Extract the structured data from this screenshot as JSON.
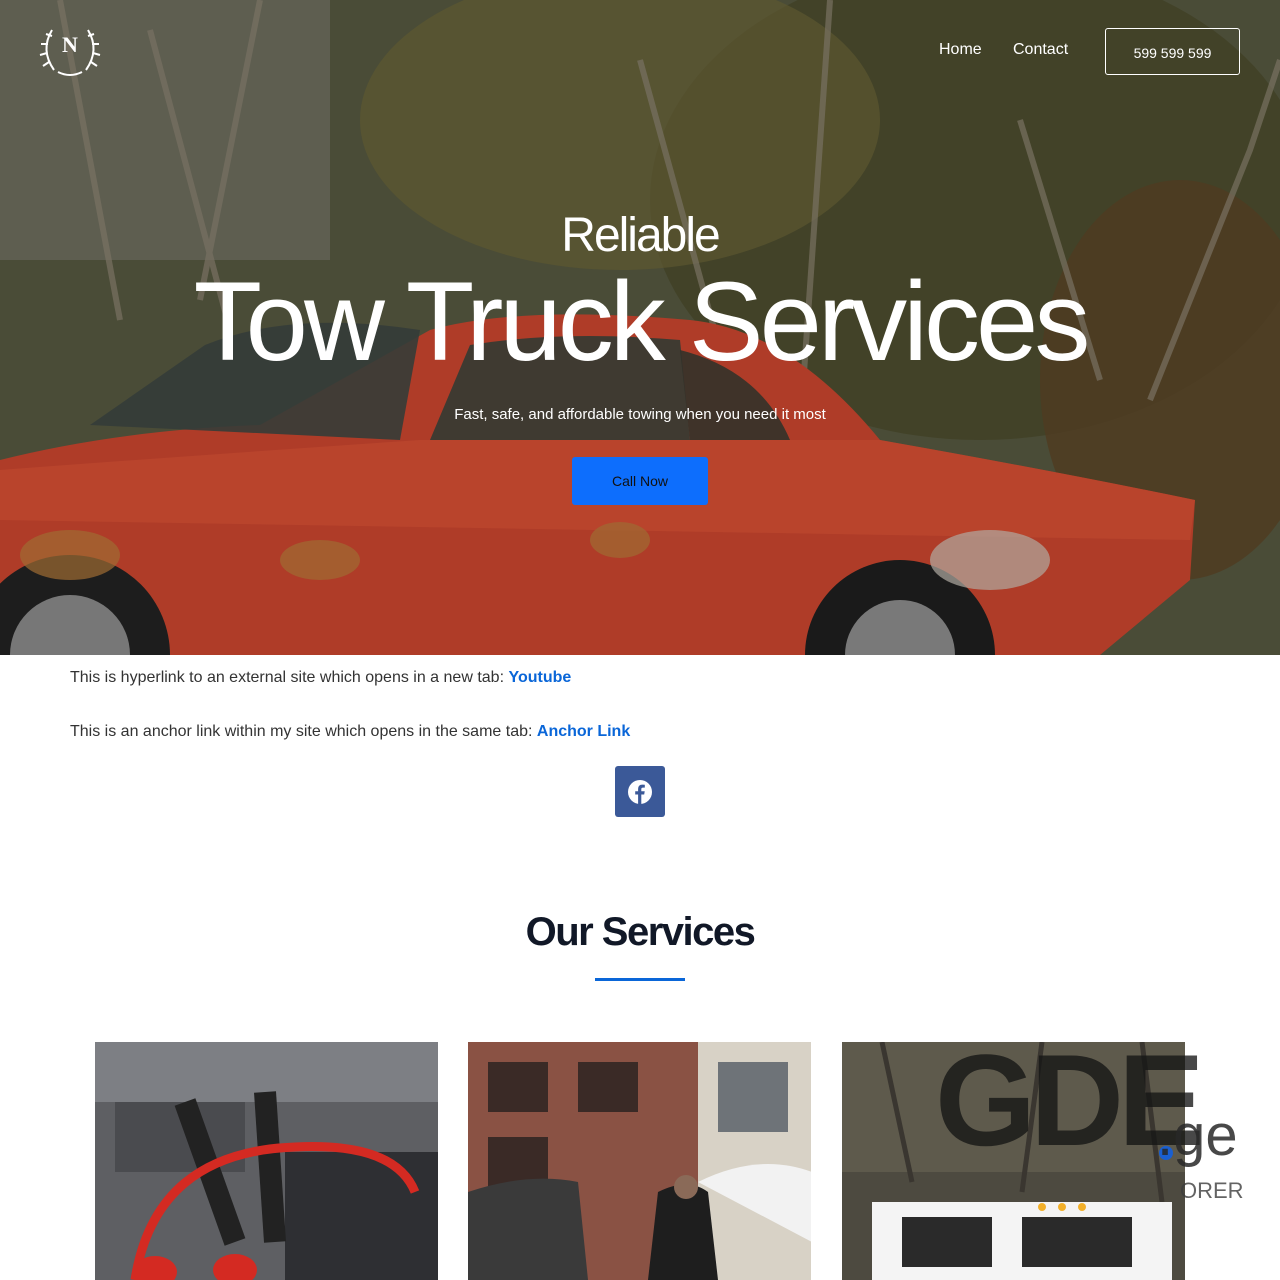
{
  "brand": {
    "logo_letter": "N",
    "logo_icon": "laurel-wreath-icon"
  },
  "nav": {
    "items": [
      {
        "label": "Home"
      },
      {
        "label": "Contact"
      }
    ],
    "phone": "599 599 599"
  },
  "hero": {
    "kicker": "Reliable",
    "title": "Tow Truck Services",
    "tagline": "Fast, safe, and affordable towing when you need it most",
    "cta": "Call Now",
    "background_image": "rusty-red-car-photo"
  },
  "links": {
    "external_text": "This is hyperlink to an external site which opens in a new tab: ",
    "external_label": "Youtube",
    "anchor_text": "This is an anchor link within my site which opens in the same tab: ",
    "anchor_label": "Anchor Link"
  },
  "social": {
    "icon": "facebook-icon",
    "color": "#3b5998"
  },
  "services": {
    "title": "Our Services",
    "cards": [
      {
        "image": "jumper-cables-photo"
      },
      {
        "image": "police-officer-car-photo"
      },
      {
        "image": "tow-truck-photo"
      }
    ]
  },
  "watermark": {
    "main": "GDE",
    "suffix": ".ge",
    "tagline": "ORER"
  },
  "colors": {
    "accent": "#0a66d8",
    "cta": "#0d6efd"
  }
}
